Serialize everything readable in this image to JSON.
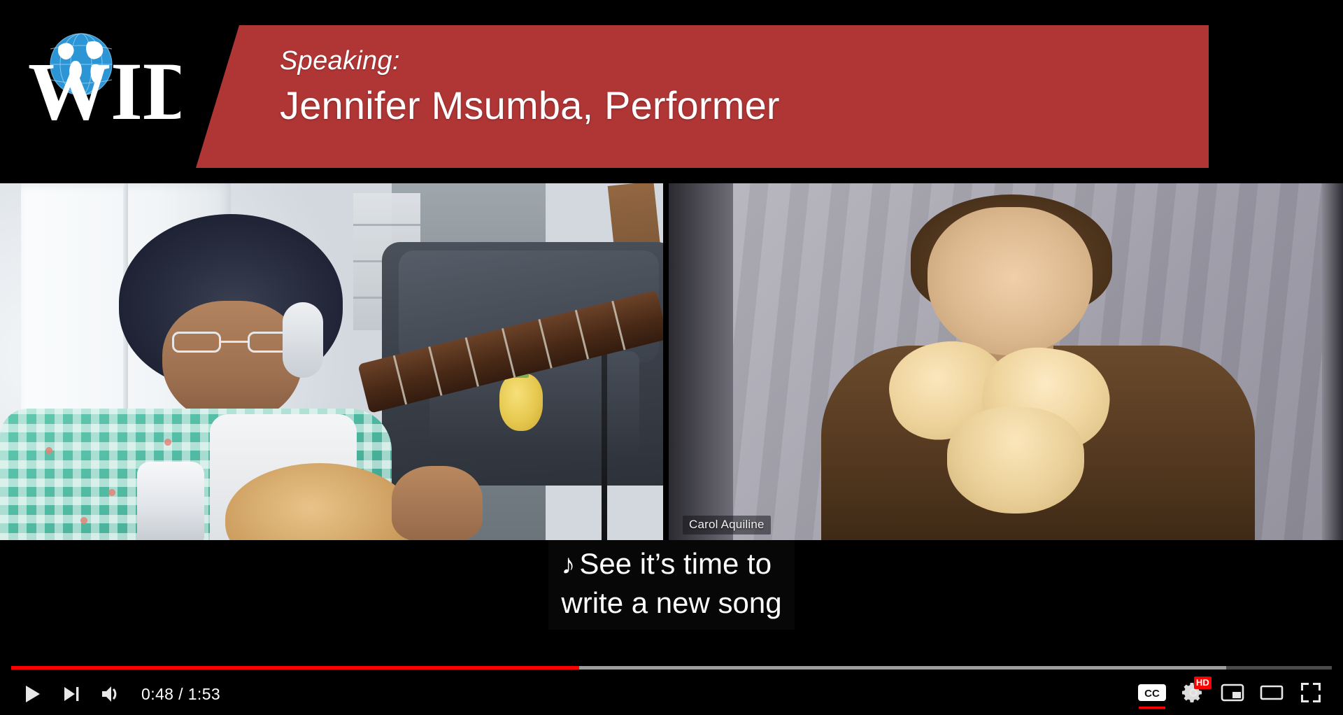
{
  "banner": {
    "speaking_label": "Speaking:",
    "speaker_name": "Jennifer Msumba, Performer",
    "accent_color": "#b03636",
    "background_color": "#000000"
  },
  "logo": {
    "wordmark": "WID",
    "globe_color": "#2b95d6",
    "wordmark_color": "#ffffff"
  },
  "video": {
    "left_pane": {
      "description": "performer playing guitar"
    },
    "right_pane": {
      "name_tag": "Carol Aquiline",
      "description": "sign language interpreter"
    }
  },
  "caption": {
    "note_symbol": "♪",
    "line1": "See it’s time to",
    "line2": "write a new song"
  },
  "controls": {
    "play_label": "Play",
    "next_label": "Next",
    "volume_label": "Mute",
    "time_current": "0:48",
    "time_separator": "/",
    "time_total": "1:53",
    "time_display": "0:48 / 1:53",
    "progress_percent": 43,
    "buffered_percent": 92,
    "progress_color": "#ff0000",
    "buffer_color": "#9d9d9d",
    "track_color": "#4a4a4a",
    "captions_label": "CC",
    "captions_active": true,
    "settings_label": "Settings",
    "quality_badge": "HD",
    "miniplayer_label": "Miniplayer",
    "theater_label": "Theater mode",
    "fullscreen_label": "Full screen"
  }
}
